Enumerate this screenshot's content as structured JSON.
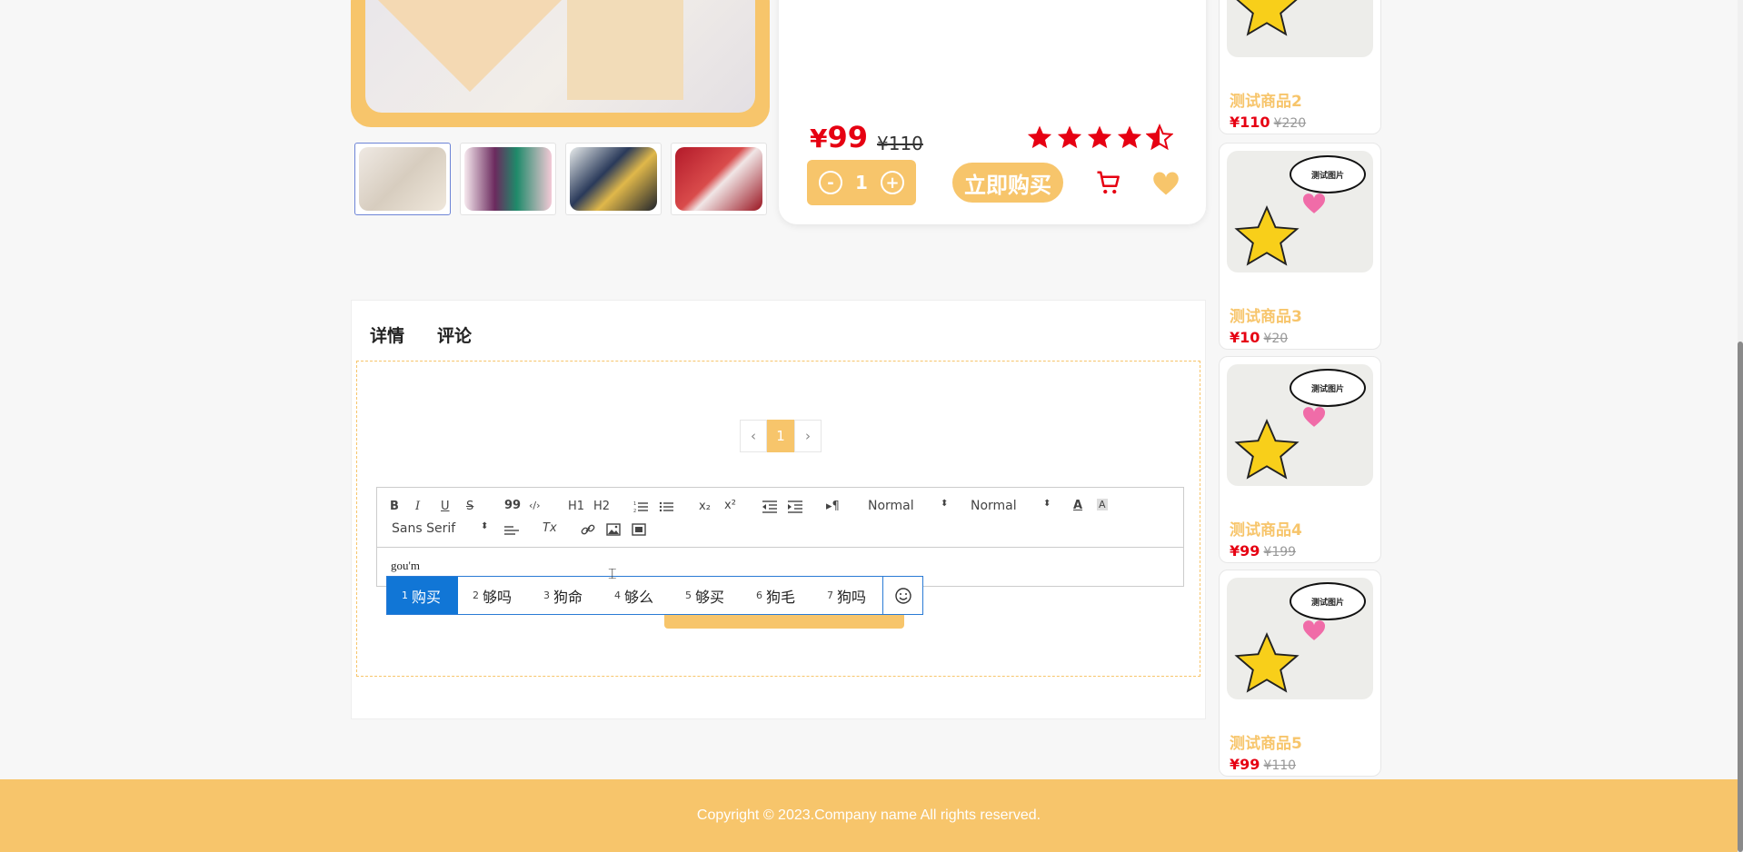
{
  "product": {
    "price_symbol": "¥",
    "price": "99",
    "old_price": "¥110",
    "rating": 4.5,
    "quantity": "1",
    "minus": "-",
    "plus": "+",
    "buy_label": "立即购买"
  },
  "tabs": [
    "详情",
    "评论"
  ],
  "pagination": {
    "prev": "‹",
    "current": "1",
    "next": "›"
  },
  "editor": {
    "toolbar": {
      "bold": "B",
      "italic": "I",
      "underline": "U",
      "strike": "S",
      "quote": "99",
      "code": "‹/›",
      "h1": "H1",
      "h2": "H2",
      "sub": "x₂",
      "sup": "x²",
      "rtl": "▸¶",
      "size_select": "Normal",
      "header_select": "Normal",
      "font_select": "Sans Serif",
      "clean": "Tx"
    },
    "content": "gou'm"
  },
  "ime": {
    "candidates": [
      {
        "n": "1",
        "text": "购买"
      },
      {
        "n": "2",
        "text": "够吗"
      },
      {
        "n": "3",
        "text": "狗命"
      },
      {
        "n": "4",
        "text": "够么"
      },
      {
        "n": "5",
        "text": "够买"
      },
      {
        "n": "6",
        "text": "狗毛"
      },
      {
        "n": "7",
        "text": "狗吗"
      }
    ]
  },
  "sidebar": [
    {
      "name": "测试商品2",
      "price": "¥110",
      "old": "¥220"
    },
    {
      "name": "测试商品3",
      "price": "¥10",
      "old": "¥20"
    },
    {
      "name": "测试商品4",
      "price": "¥99",
      "old": "¥199"
    },
    {
      "name": "测试商品5",
      "price": "¥99",
      "old": "¥110"
    }
  ],
  "sidebar_bubble": "测试图片",
  "footer": {
    "copyright": "Copyright © 2023.Company name All rights reserved."
  },
  "colors": {
    "accent": "#f7c56b",
    "price": "#e60012",
    "ime_blue": "#1176d6"
  }
}
